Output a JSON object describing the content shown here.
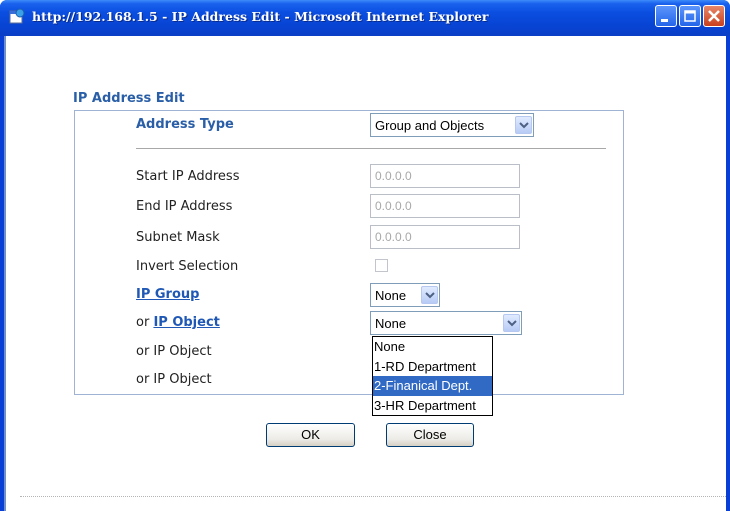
{
  "window": {
    "title": "http://192.168.1.5 - IP Address Edit - Microsoft Internet Explorer",
    "buttons": [
      "minimize",
      "maximize",
      "close"
    ]
  },
  "form": {
    "section_title": "IP Address Edit",
    "address_type": {
      "label": "Address Type",
      "value": "Group and Objects"
    },
    "start_ip": {
      "label": "Start IP Address",
      "value": "0.0.0.0"
    },
    "end_ip": {
      "label": "End IP Address",
      "value": "0.0.0.0"
    },
    "subnet_mask": {
      "label": "Subnet Mask",
      "value": "0.0.0.0"
    },
    "invert_selection": {
      "label": "Invert Selection",
      "checked": false
    },
    "ip_group": {
      "label": "IP Group",
      "value": "None"
    },
    "ip_object_1": {
      "prefix": "or ",
      "link": "IP Object",
      "value": "None"
    },
    "ip_object_2": {
      "label": "or IP Object"
    },
    "ip_object_3": {
      "label": "or IP Object"
    }
  },
  "dropdown": {
    "options": [
      "None",
      "1-RD Department",
      "2-Finanical Dept.",
      "3-HR Department"
    ],
    "highlighted_index": 2
  },
  "actions": {
    "ok_label": "OK",
    "close_label": "Close"
  },
  "colors": {
    "titlebar": "#0a4ee0",
    "heading": "#2a5fa8",
    "link": "#1f58b5",
    "selection": "#316ac5"
  },
  "icons": {
    "title": "ie-page-icon",
    "select_arrow": "chevron-down-icon"
  }
}
